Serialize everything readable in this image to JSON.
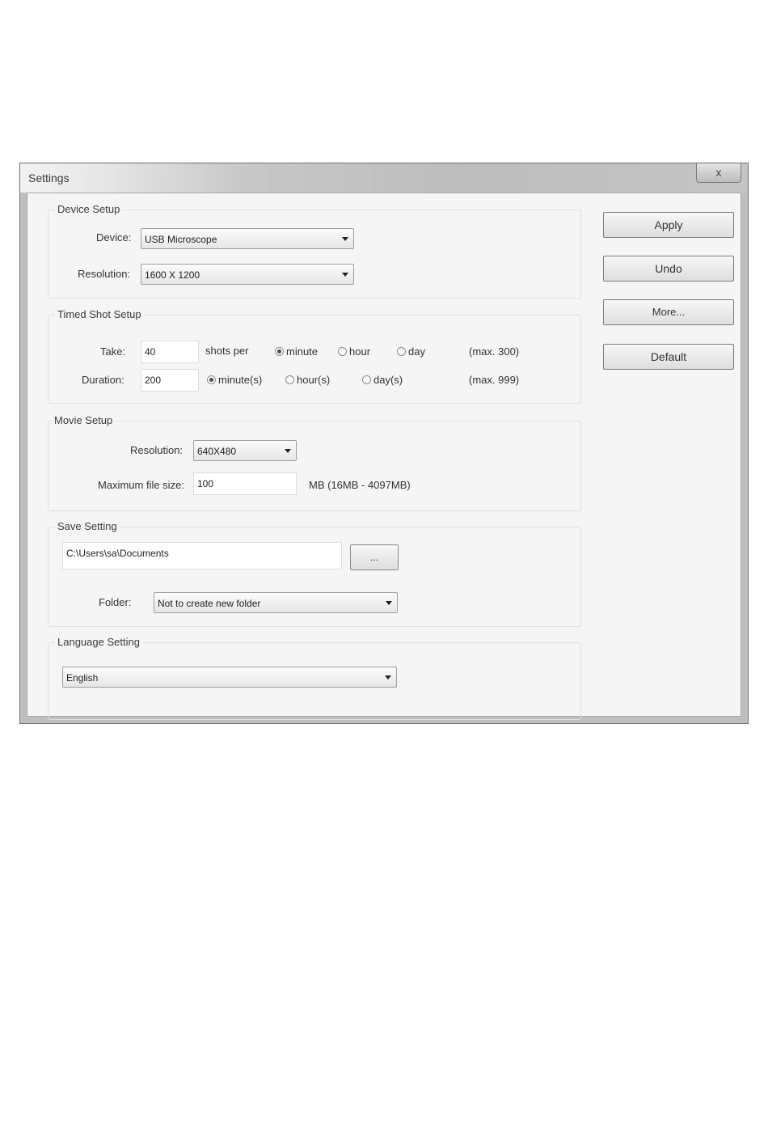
{
  "window": {
    "title": "Settings",
    "close_label": "x"
  },
  "device_setup": {
    "legend": "Device Setup",
    "device_label": "Device:",
    "device_value": "USB Microscope",
    "resolution_label": "Resolution:",
    "resolution_value": "1600 X 1200"
  },
  "timed_shot": {
    "legend": "Timed Shot Setup",
    "take_label": "Take:",
    "take_value": "40",
    "shots_per": "shots per",
    "take_units": [
      "minute",
      "hour",
      "day"
    ],
    "take_selected": "minute",
    "take_max": "(max. 300)",
    "duration_label": "Duration:",
    "duration_value": "200",
    "duration_units": [
      "minute(s)",
      "hour(s)",
      "day(s)"
    ],
    "duration_selected": "minute(s)",
    "duration_max": "(max. 999)"
  },
  "movie_setup": {
    "legend": "Movie Setup",
    "resolution_label": "Resolution:",
    "resolution_value": "640X480",
    "max_size_label": "Maximum file size:",
    "max_size_value": "100",
    "size_hint": "MB (16MB - 4097MB)"
  },
  "save_setting": {
    "legend": "Save Setting",
    "path_value": "C:\\Users\\sa\\Documents",
    "browse_label": "...",
    "folder_label": "Folder:",
    "folder_value": "Not to create new folder"
  },
  "language_setting": {
    "legend": "Language Setting",
    "language_value": "English"
  },
  "buttons": {
    "apply": "Apply",
    "undo": "Undo",
    "more": "More...",
    "default": "Default"
  }
}
